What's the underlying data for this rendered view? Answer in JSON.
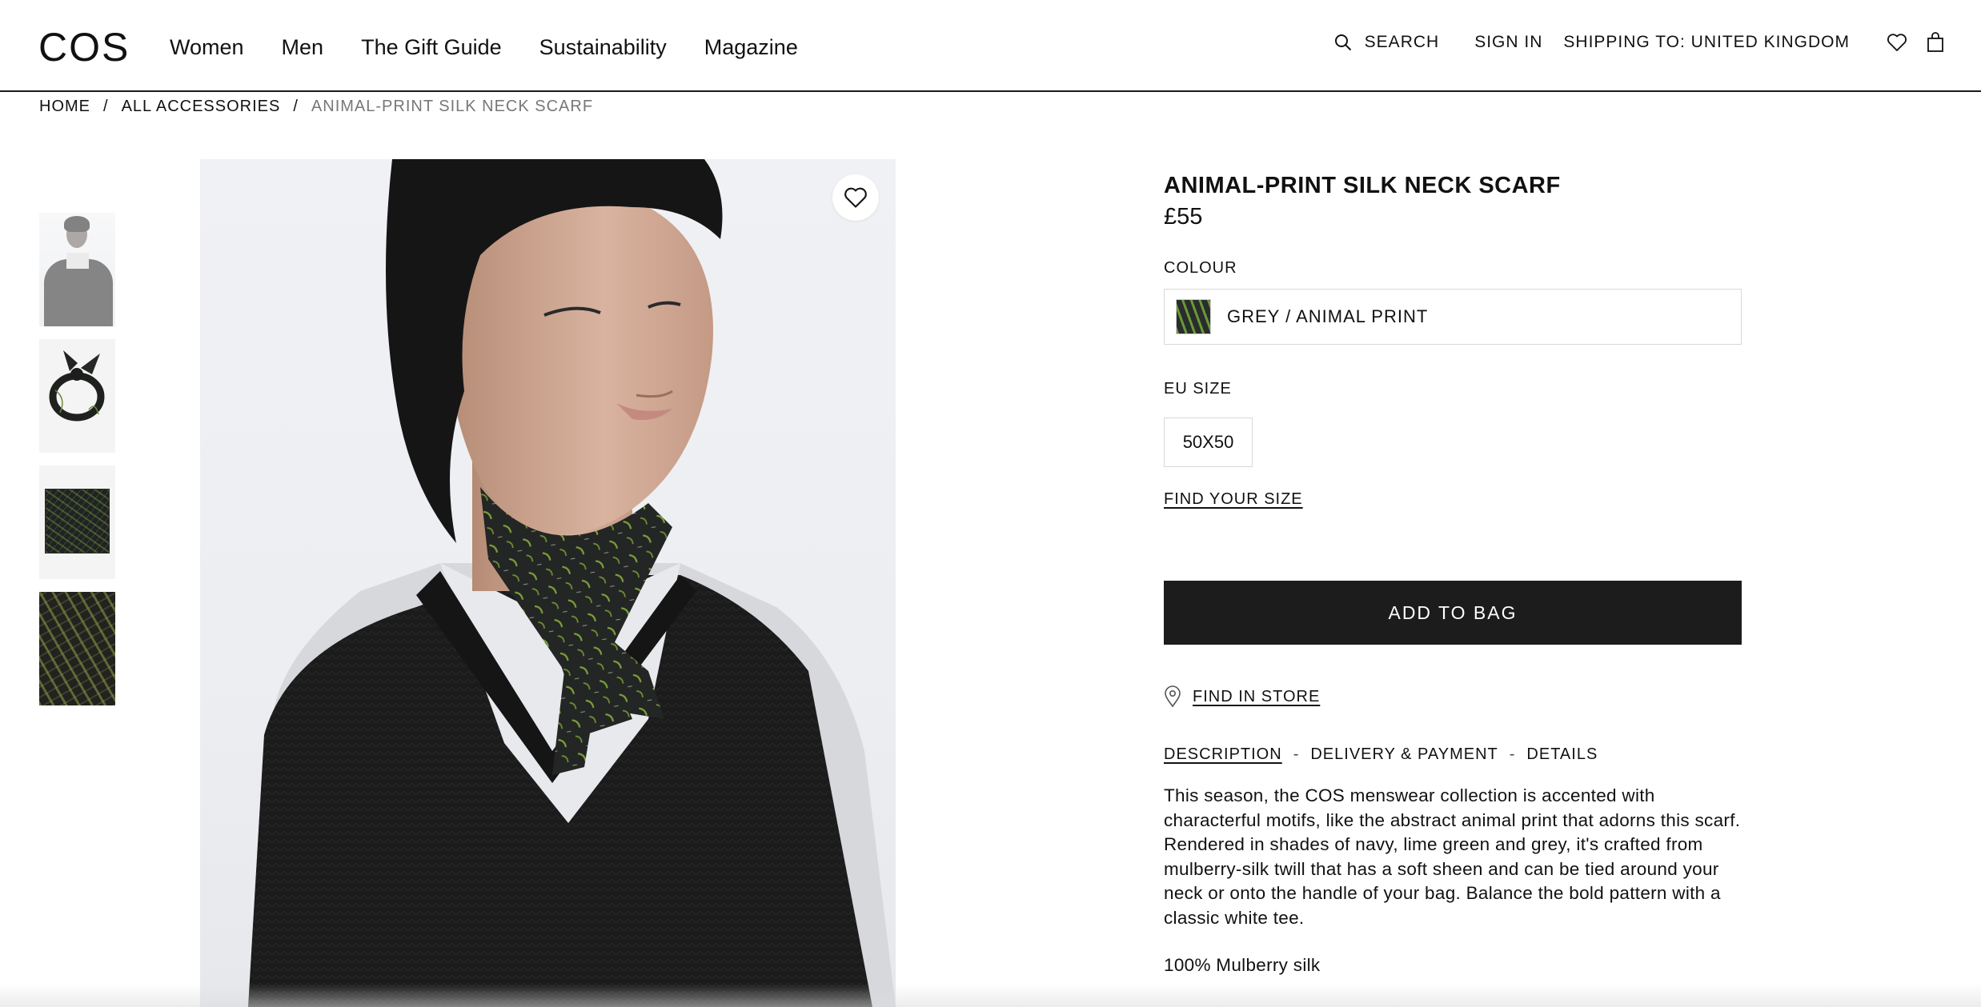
{
  "header": {
    "logo": "COS",
    "nav": [
      "Women",
      "Men",
      "The Gift Guide",
      "Sustainability",
      "Magazine"
    ],
    "search_label": "SEARCH",
    "signin_label": "SIGN IN",
    "shipping_label": "SHIPPING TO: UNITED KINGDOM",
    "icons": [
      "search-icon",
      "heart-icon",
      "bag-icon"
    ]
  },
  "breadcrumb": {
    "items": [
      "HOME",
      "ALL ACCESSORIES",
      "ANIMAL-PRINT SILK NECK SCARF"
    ],
    "separator": "/"
  },
  "gallery": {
    "thumbnails": [
      "model wearing scarf",
      "scarf tied in knot",
      "scarf folded flat",
      "scarf print close-up"
    ]
  },
  "product": {
    "title": "ANIMAL-PRINT SILK NECK SCARF",
    "price": "£55",
    "colour_label": "COLOUR",
    "colour_value": "GREY / ANIMAL PRINT",
    "size_label": "EU SIZE",
    "size_value": "50X50",
    "find_size_label": "FIND YOUR SIZE",
    "add_to_bag_label": "ADD TO BAG",
    "find_store_label": "FIND IN STORE",
    "tabs": [
      "DESCRIPTION",
      "DELIVERY & PAYMENT",
      "DETAILS"
    ],
    "active_tab": "DESCRIPTION",
    "description": "This season, the COS menswear collection is accented with characterful motifs, like the abstract animal print that adorns this scarf. Rendered in shades of navy, lime green and grey, it's crafted from mulberry-silk twill that has a soft sheen and can be tied around your neck or onto the handle of your bag. Balance the bold pattern with a classic white tee.",
    "material": "100% Mulberry silk"
  },
  "colors": {
    "text": "#111111",
    "button_bg": "#1c1c1c",
    "button_text": "#ffffff",
    "border": "#d8d8d8",
    "muted": "#777777"
  }
}
